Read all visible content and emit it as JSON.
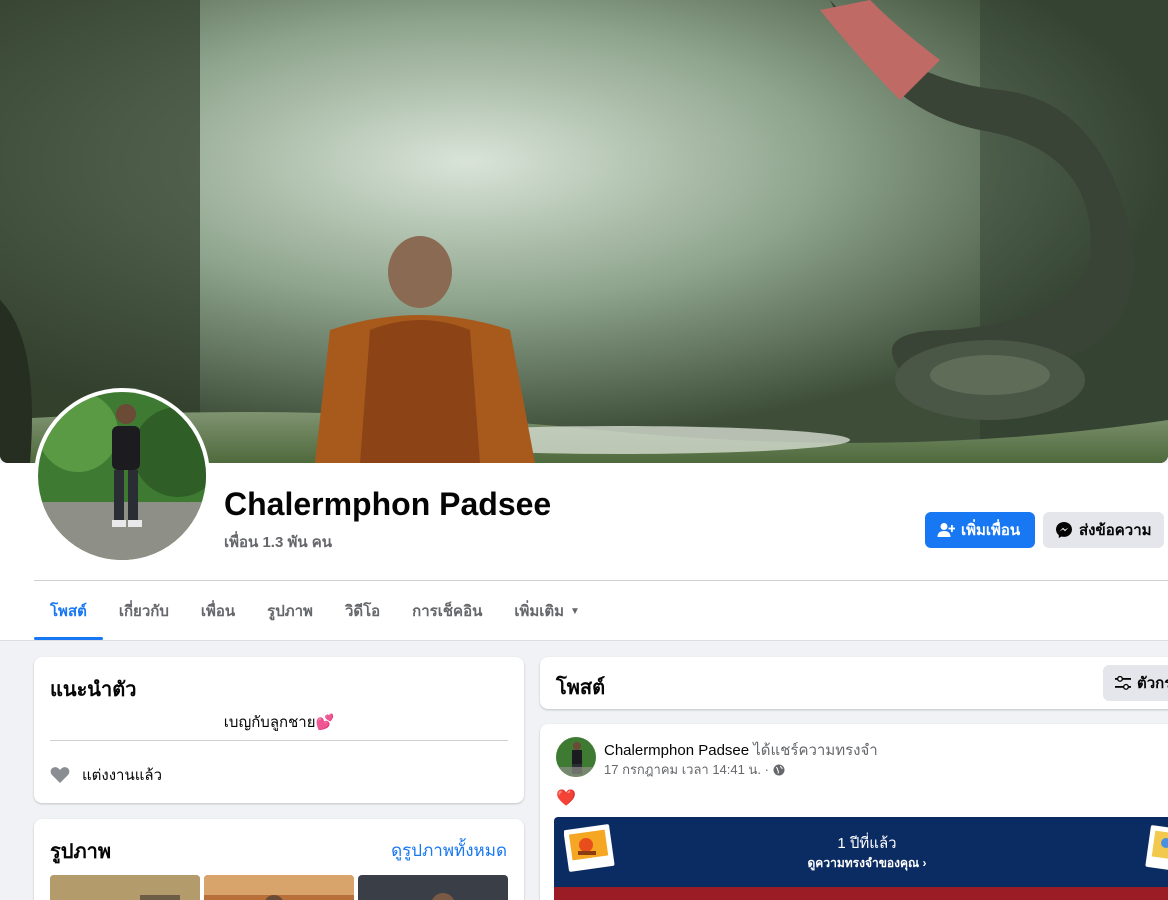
{
  "profile": {
    "name": "Chalermphon Padsee",
    "friends": "เพื่อน 1.3 พัน คน"
  },
  "actions": {
    "add_friend": "เพิ่มเพื่อน",
    "message": "ส่งข้อความ"
  },
  "tabs": [
    {
      "label": "โพสต์",
      "active": true
    },
    {
      "label": "เกี่ยวกับ",
      "active": false
    },
    {
      "label": "เพื่อน",
      "active": false
    },
    {
      "label": "รูปภาพ",
      "active": false
    },
    {
      "label": "วิดีโอ",
      "active": false
    },
    {
      "label": "การเช็คอิน",
      "active": false
    },
    {
      "label": "เพิ่มเติม",
      "active": false
    }
  ],
  "intro": {
    "title": "แนะนำตัว",
    "bio": "เบญกับลูกชาย💕",
    "relationship": "แต่งงานแล้ว"
  },
  "photos": {
    "title": "รูปภาพ",
    "see_all": "ดูรูปภาพทั้งหมด"
  },
  "posts": {
    "title": "โพสต์",
    "filter_label": "ตัวกร"
  },
  "post": {
    "author": "Chalermphon Padsee",
    "action": "ได้แชร์ความทรงจำ",
    "timestamp": "17 กรกฎาคม เวลา 14:41 น. ·",
    "reaction": "❤️",
    "memory_years": "1 ปีที่แล้ว",
    "memory_link": "ดูความทรงจำของคุณ"
  },
  "colors": {
    "accent": "#1877f2",
    "memory_bg": "#0b2b63",
    "memory_strip": "#9b1c25"
  }
}
